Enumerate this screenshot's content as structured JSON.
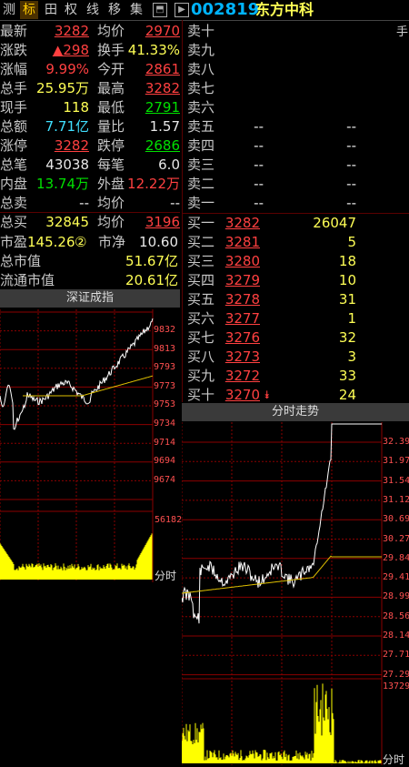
{
  "tabs": [
    "测",
    "标",
    "田",
    "权",
    "线",
    "移",
    "集"
  ],
  "stock": {
    "code": "002819",
    "name": "东方中科",
    "hand_label": "手"
  },
  "quote_rows": [
    {
      "l1": "最新",
      "v1": "3282",
      "c1": "red",
      "u1": true,
      "l2": "均价",
      "v2": "2970",
      "c2": "red",
      "u2": true
    },
    {
      "l1": "涨跌",
      "v1": "▲298",
      "c1": "red",
      "u1": true,
      "l2": "换手",
      "v2": "41.33%",
      "c2": "yel",
      "u2": false
    },
    {
      "l1": "涨幅",
      "v1": "9.99%",
      "c1": "red",
      "u1": false,
      "l2": "今开",
      "v2": "2861",
      "c2": "red",
      "u2": true
    },
    {
      "l1": "总手",
      "v1": "25.95万",
      "c1": "yel",
      "u1": false,
      "l2": "最高",
      "v2": "3282",
      "c2": "red",
      "u2": true
    },
    {
      "l1": "现手",
      "v1": "118",
      "c1": "yel",
      "u1": false,
      "l2": "最低",
      "v2": "2791",
      "c2": "grn",
      "u2": true
    },
    {
      "l1": "总额",
      "v1": "7.71亿",
      "c1": "cyn",
      "u1": false,
      "l2": "量比",
      "v2": "1.57",
      "c2": "wht",
      "u2": false
    },
    {
      "l1": "涨停",
      "v1": "3282",
      "c1": "red",
      "u1": true,
      "l2": "跌停",
      "v2": "2686",
      "c2": "grn",
      "u2": true
    },
    {
      "l1": "总笔",
      "v1": "43038",
      "c1": "wht",
      "u1": false,
      "l2": "每笔",
      "v2": "6.0",
      "c2": "wht",
      "u2": false
    },
    {
      "l1": "内盘",
      "v1": "13.74万",
      "c1": "grn",
      "u1": false,
      "l2": "外盘",
      "v2": "12.22万",
      "c2": "red",
      "u2": false
    },
    {
      "l1": "总卖",
      "v1": "--",
      "c1": "wht",
      "u1": false,
      "l2": "均价",
      "v2": "--",
      "c2": "wht",
      "u2": false
    },
    {
      "l1": "总买",
      "v1": "32845",
      "c1": "yel",
      "u1": false,
      "l2": "均价",
      "v2": "3196",
      "c2": "red",
      "u2": true
    }
  ],
  "pe": {
    "label": "市盈",
    "value": "145.26",
    "badge": "②",
    "nav_label": "市净",
    "nav": "10.60"
  },
  "total_mv": {
    "label": "总市值",
    "value": "51.67亿"
  },
  "float_mv": {
    "label": "流通市值",
    "value": "20.61亿"
  },
  "sell": [
    {
      "label": "卖十",
      "price": "",
      "vol": ""
    },
    {
      "label": "卖九",
      "price": "",
      "vol": ""
    },
    {
      "label": "卖八",
      "price": "",
      "vol": ""
    },
    {
      "label": "卖七",
      "price": "",
      "vol": ""
    },
    {
      "label": "卖六",
      "price": "",
      "vol": ""
    },
    {
      "label": "卖五",
      "price": "--",
      "vol": "--"
    },
    {
      "label": "卖四",
      "price": "--",
      "vol": "--"
    },
    {
      "label": "卖三",
      "price": "--",
      "vol": "--"
    },
    {
      "label": "卖二",
      "price": "--",
      "vol": "--"
    },
    {
      "label": "卖一",
      "price": "--",
      "vol": "--"
    }
  ],
  "buy": [
    {
      "label": "买一",
      "price": "3282",
      "vol": "26047",
      "arrow": ""
    },
    {
      "label": "买二",
      "price": "3281",
      "vol": "5",
      "arrow": ""
    },
    {
      "label": "买三",
      "price": "3280",
      "vol": "18",
      "arrow": ""
    },
    {
      "label": "买四",
      "price": "3279",
      "vol": "10",
      "arrow": ""
    },
    {
      "label": "买五",
      "price": "3278",
      "vol": "31",
      "arrow": ""
    },
    {
      "label": "买六",
      "price": "3277",
      "vol": "1",
      "arrow": ""
    },
    {
      "label": "买七",
      "price": "3276",
      "vol": "32",
      "arrow": ""
    },
    {
      "label": "买八",
      "price": "3273",
      "vol": "3",
      "arrow": ""
    },
    {
      "label": "买九",
      "price": "3272",
      "vol": "33",
      "arrow": ""
    },
    {
      "label": "买十",
      "price": "3270",
      "vol": "24",
      "arrow": "⯯"
    }
  ],
  "index_panel": {
    "title": "深证成指",
    "price_ticks": [
      "9832",
      "9813",
      "9793",
      "9773",
      "9753",
      "9734",
      "9714",
      "9694",
      "9674"
    ],
    "vol_tick": "56182",
    "time_label": "分时"
  },
  "intraday_panel": {
    "title": "分时走势",
    "price_ticks": [
      "32.39",
      "31.97",
      "31.54",
      "31.12",
      "30.69",
      "30.27",
      "29.84",
      "29.41",
      "28.99",
      "28.56",
      "28.14",
      "27.71",
      "27.29"
    ],
    "vol_tick": "13729",
    "time_label": "分时"
  },
  "colors": {
    "up": "#ff4040",
    "down": "#00e000",
    "yellow": "#ffff55",
    "grid": "#8b0000",
    "avg_line": "#e0c000",
    "price_line": "#ffffff",
    "vol": "#ffff00"
  }
}
